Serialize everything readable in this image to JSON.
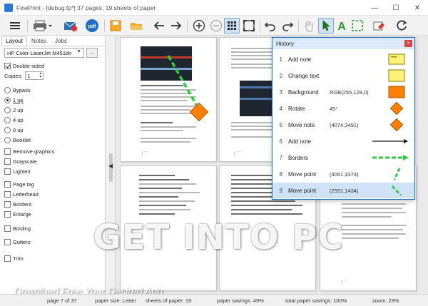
{
  "window": {
    "title": "FinePrint - [debug.fp*] 37 pages, 19 sheets of paper"
  },
  "left_panel": {
    "tabs": [
      "Layout",
      "Notes",
      "Jobs"
    ],
    "printer": "HP Color LaserJet M451dn",
    "printer_more": "...",
    "double_sided": "Double-sided",
    "copies_label": "Copies:",
    "copies_value": "1",
    "layout_options": [
      "Bypass",
      "1 up",
      "2 up",
      "4 up",
      "8 up",
      "Booklet"
    ],
    "checkboxes": [
      "Remove graphics",
      "Grayscale",
      "Lighten",
      "Page tag",
      "Letterhead",
      "Borders",
      "Enlarge",
      "Binding",
      "Gutters",
      "Trim"
    ]
  },
  "history": {
    "title": "History",
    "close": "x",
    "rows": [
      {
        "num": "1",
        "action": "Add note",
        "value": ""
      },
      {
        "num": "2",
        "action": "Change text",
        "value": ""
      },
      {
        "num": "3",
        "action": "Background",
        "value": "RGB(255,128,0)"
      },
      {
        "num": "4",
        "action": "Rotate",
        "value": "45°"
      },
      {
        "num": "5",
        "action": "Move note",
        "value": "(4074,3491)"
      },
      {
        "num": "6",
        "action": "Add note",
        "value": ""
      },
      {
        "num": "7",
        "action": "Borders",
        "value": ""
      },
      {
        "num": "8",
        "action": "Move point",
        "value": "(4061,3373)"
      },
      {
        "num": "9",
        "action": "Move point",
        "value": "(2551,1434)"
      }
    ],
    "selected_row": 9
  },
  "watermark": {
    "main": "GET INTO PC",
    "sub": "Download Free Your Desired App"
  },
  "status": {
    "page": "page 7 of 37",
    "paper_size": "paper size: Letter",
    "sheets": "sheets of paper: 19",
    "savings": "paper savings: 49%",
    "total_savings": "total paper savings: 100%",
    "zoom": "zoom: 23%"
  },
  "colors": {
    "accent": "#1b73c9",
    "note_yellow": "#fff27a",
    "note_orange": "#ff8000",
    "arrow_green": "#2ecc40"
  }
}
